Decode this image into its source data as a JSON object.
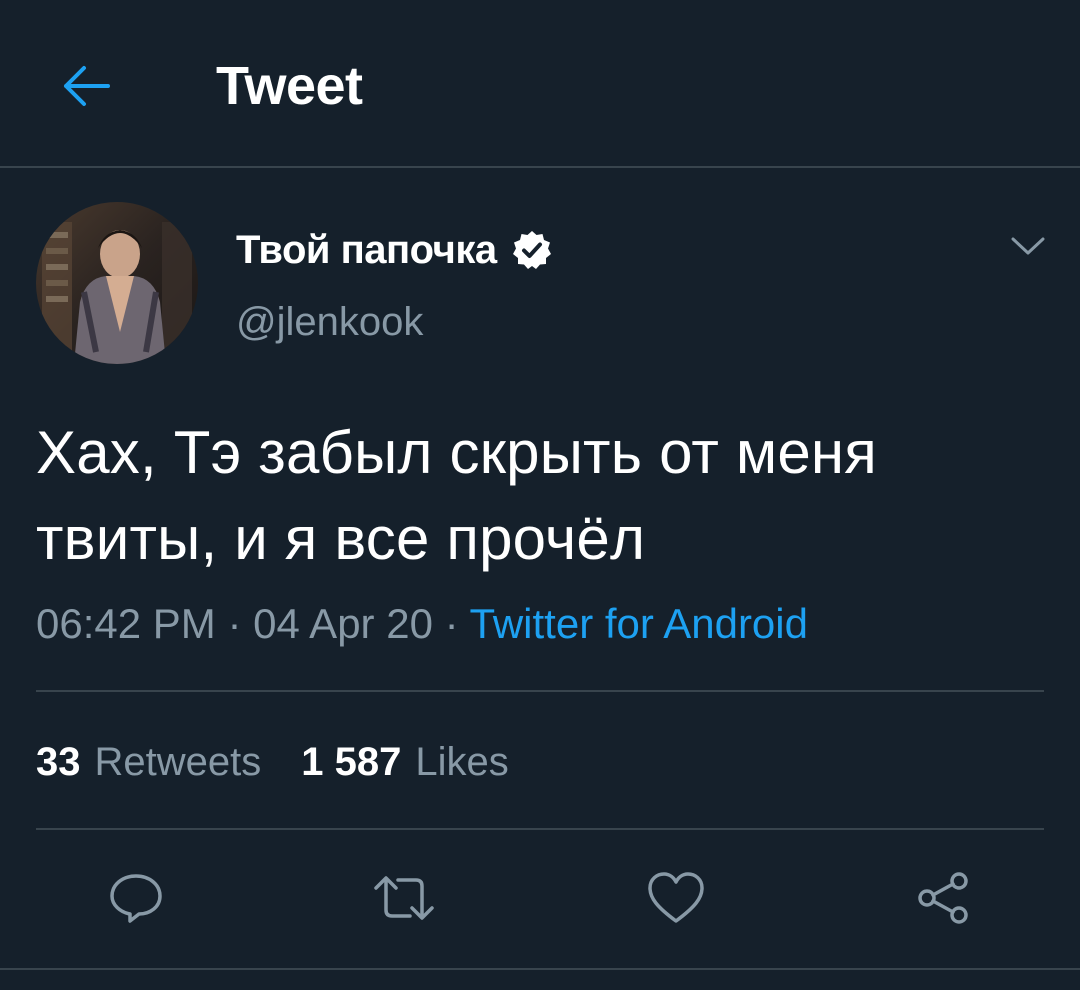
{
  "header": {
    "title": "Tweet",
    "back_icon": "arrow-left-icon",
    "accent_color": "#1da1f2"
  },
  "author": {
    "display_name": "Твой папочка",
    "verified": true,
    "handle": "@jlenkook",
    "more_icon": "chevron-down-icon"
  },
  "tweet": {
    "text": "Хах, Тэ забыл скрыть от меня твиты, и я все прочёл",
    "time": "06:42 PM",
    "date": "04 Apr 20",
    "separator": " · ",
    "source": "Twitter for Android"
  },
  "stats": {
    "retweets_count": "33",
    "retweets_label": "Retweets",
    "likes_count": "1 587",
    "likes_label": "Likes"
  },
  "actions": [
    {
      "name": "reply",
      "icon": "reply-icon"
    },
    {
      "name": "retweet",
      "icon": "retweet-icon"
    },
    {
      "name": "like",
      "icon": "heart-icon"
    },
    {
      "name": "share",
      "icon": "share-icon"
    }
  ],
  "colors": {
    "background": "#15202b",
    "secondary_text": "#8899a6",
    "divider": "#38444d",
    "link": "#1da1f2"
  }
}
